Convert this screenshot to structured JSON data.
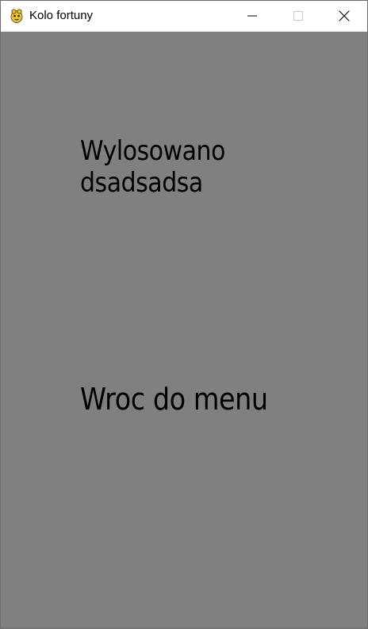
{
  "window": {
    "title": "Kolo fortuny",
    "icon": "pygame-snake-icon",
    "controls": {
      "minimize_icon": "minimize-icon",
      "maximize_icon": "maximize-icon",
      "close_icon": "close-icon"
    }
  },
  "colors": {
    "background": "#808080",
    "text": "#000000",
    "titlebar": "#ffffff"
  },
  "result": {
    "line1": "Wylosowano",
    "line2": "dsadsadsa"
  },
  "menu_button": {
    "label": "Wroc do menu"
  }
}
